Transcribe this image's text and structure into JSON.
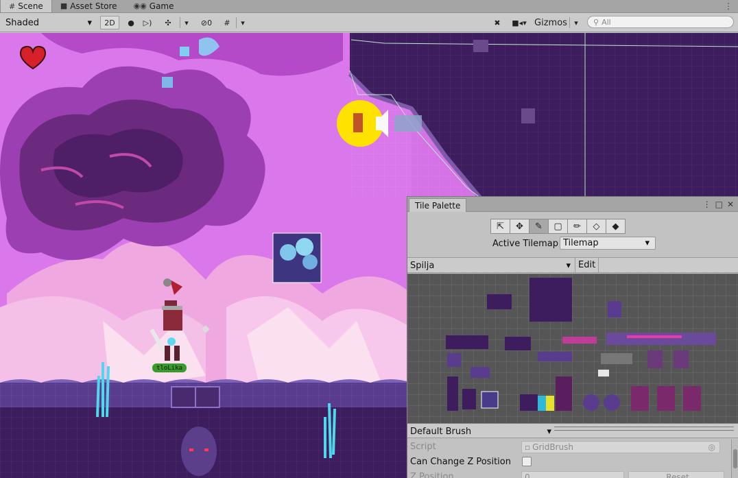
{
  "tabs": [
    {
      "label": "Scene",
      "icon": "hash-icon",
      "active": true
    },
    {
      "label": "Asset Store",
      "icon": "bag-icon",
      "active": false
    },
    {
      "label": "Game",
      "icon": "gamepad-icon",
      "active": false
    }
  ],
  "toolbar": {
    "shading_mode": "Shaded",
    "mode_2d_label": "2D",
    "hidden_count": "0",
    "gizmos_label": "Gizmos",
    "search_placeholder": "All"
  },
  "scene": {
    "player_label": "tloLika"
  },
  "tile_palette": {
    "title": "Tile Palette",
    "tools": [
      "select-tool",
      "move-tool",
      "paint-brush-tool",
      "box-fill-tool",
      "picker-tool",
      "eraser-tool",
      "flood-fill-tool"
    ],
    "active_tool_index": 2,
    "active_tilemap_label": "Active Tilemap",
    "active_tilemap_value": "Tilemap",
    "palette_name": "Spilja",
    "edit_label": "Edit",
    "brush_name": "Default Brush",
    "properties": {
      "script_label": "Script",
      "script_value": "GridBrush",
      "can_change_z_label": "Can Change Z Position",
      "z_position_label": "Z Position",
      "z_position_value": "0",
      "reset_label": "Reset"
    }
  },
  "colors": {
    "sky_purple": "#d472e6",
    "cloud_dark": "#6b2a7e",
    "cave_dark": "#3e1d5e",
    "ground": "#5a3c8e",
    "crystal": "#5fd8e8",
    "heart": "#d8202a"
  }
}
